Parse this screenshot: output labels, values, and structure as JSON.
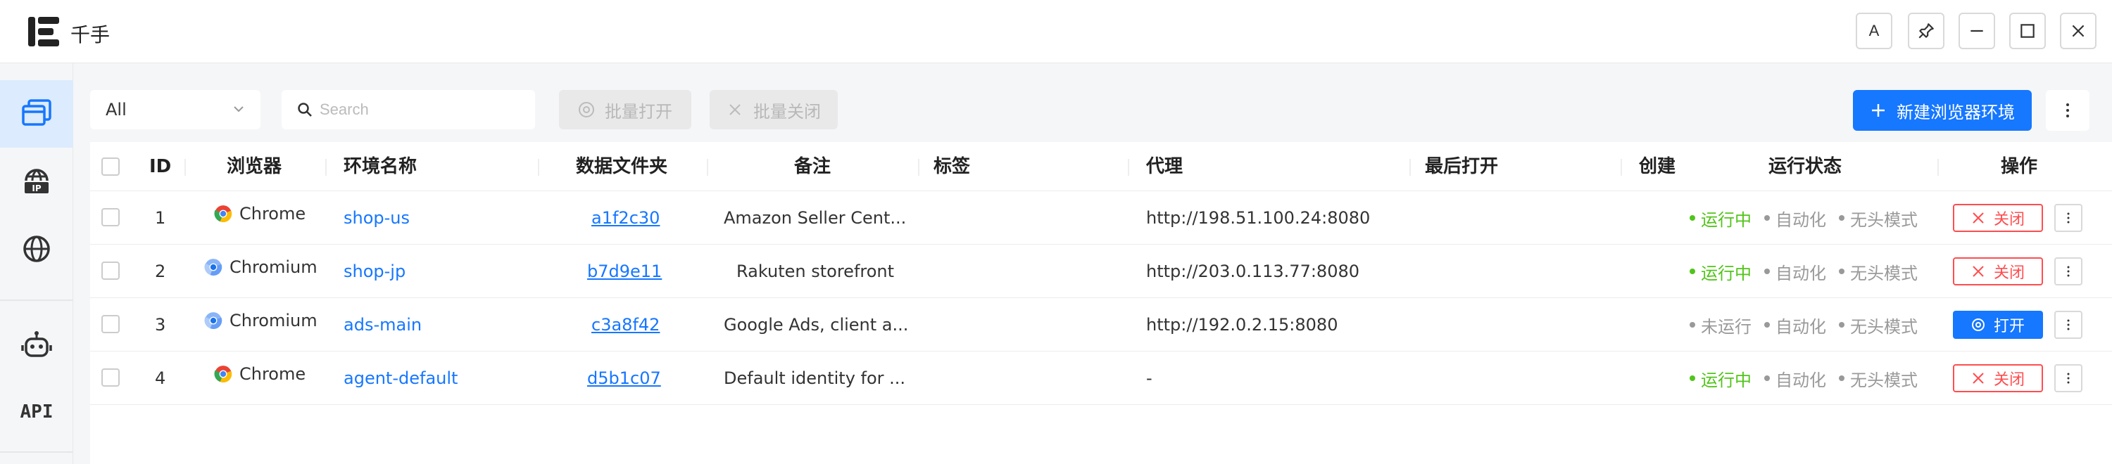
{
  "app": {
    "title": "千手"
  },
  "window_controls": {
    "translate_label": "A"
  },
  "sidebar": {
    "api_label": "API"
  },
  "toolbar": {
    "filter_value": "All",
    "search_placeholder": "Search",
    "batch_open_label": "批量打开",
    "batch_close_label": "批量关闭",
    "new_env_label": "新建浏览器环境"
  },
  "table": {
    "headers": {
      "id": "ID",
      "browser": "浏览器",
      "env_name": "环境名称",
      "data_folder": "数据文件夹",
      "note": "备注",
      "tags": "标签",
      "proxy": "代理",
      "last_opened": "最后打开",
      "created": "创建",
      "status": "运行状态",
      "actions": "操作"
    },
    "rows": [
      {
        "id": "1",
        "browser": "Chrome",
        "env_name": "shop-us",
        "data_folder": "a1f2c30",
        "note": "Amazon Seller Cent...",
        "proxy": "http://198.51.100.24:8080",
        "run_status": "运行中",
        "automation": "自动化",
        "headless": "无头模式",
        "action": "关闭"
      },
      {
        "id": "2",
        "browser": "Chromium",
        "env_name": "shop-jp",
        "data_folder": "b7d9e11",
        "note": "Rakuten storefront",
        "proxy": "http://203.0.113.77:8080",
        "run_status": "运行中",
        "automation": "自动化",
        "headless": "无头模式",
        "action": "关闭"
      },
      {
        "id": "3",
        "browser": "Chromium",
        "env_name": "ads-main",
        "data_folder": "c3a8f42",
        "note": "Google Ads, client a...",
        "proxy": "http://192.0.2.15:8080",
        "run_status": "未运行",
        "automation": "自动化",
        "headless": "无头模式",
        "action": "打开"
      },
      {
        "id": "4",
        "browser": "Chrome",
        "env_name": "agent-default",
        "data_folder": "d5b1c07",
        "note": "Default identity for ...",
        "proxy": "-",
        "run_status": "运行中",
        "automation": "自动化",
        "headless": "无头模式",
        "action": "关闭"
      }
    ]
  },
  "colors": {
    "accent": "#1677ff",
    "running": "#52c41a",
    "stopped": "#999999",
    "danger": "#ff4d4f"
  },
  "icons": {
    "logo": "app-logo-icon",
    "sidebar": [
      "browser-windows-icon",
      "ip-globe-icon",
      "globe-icon",
      "robot-icon"
    ]
  }
}
